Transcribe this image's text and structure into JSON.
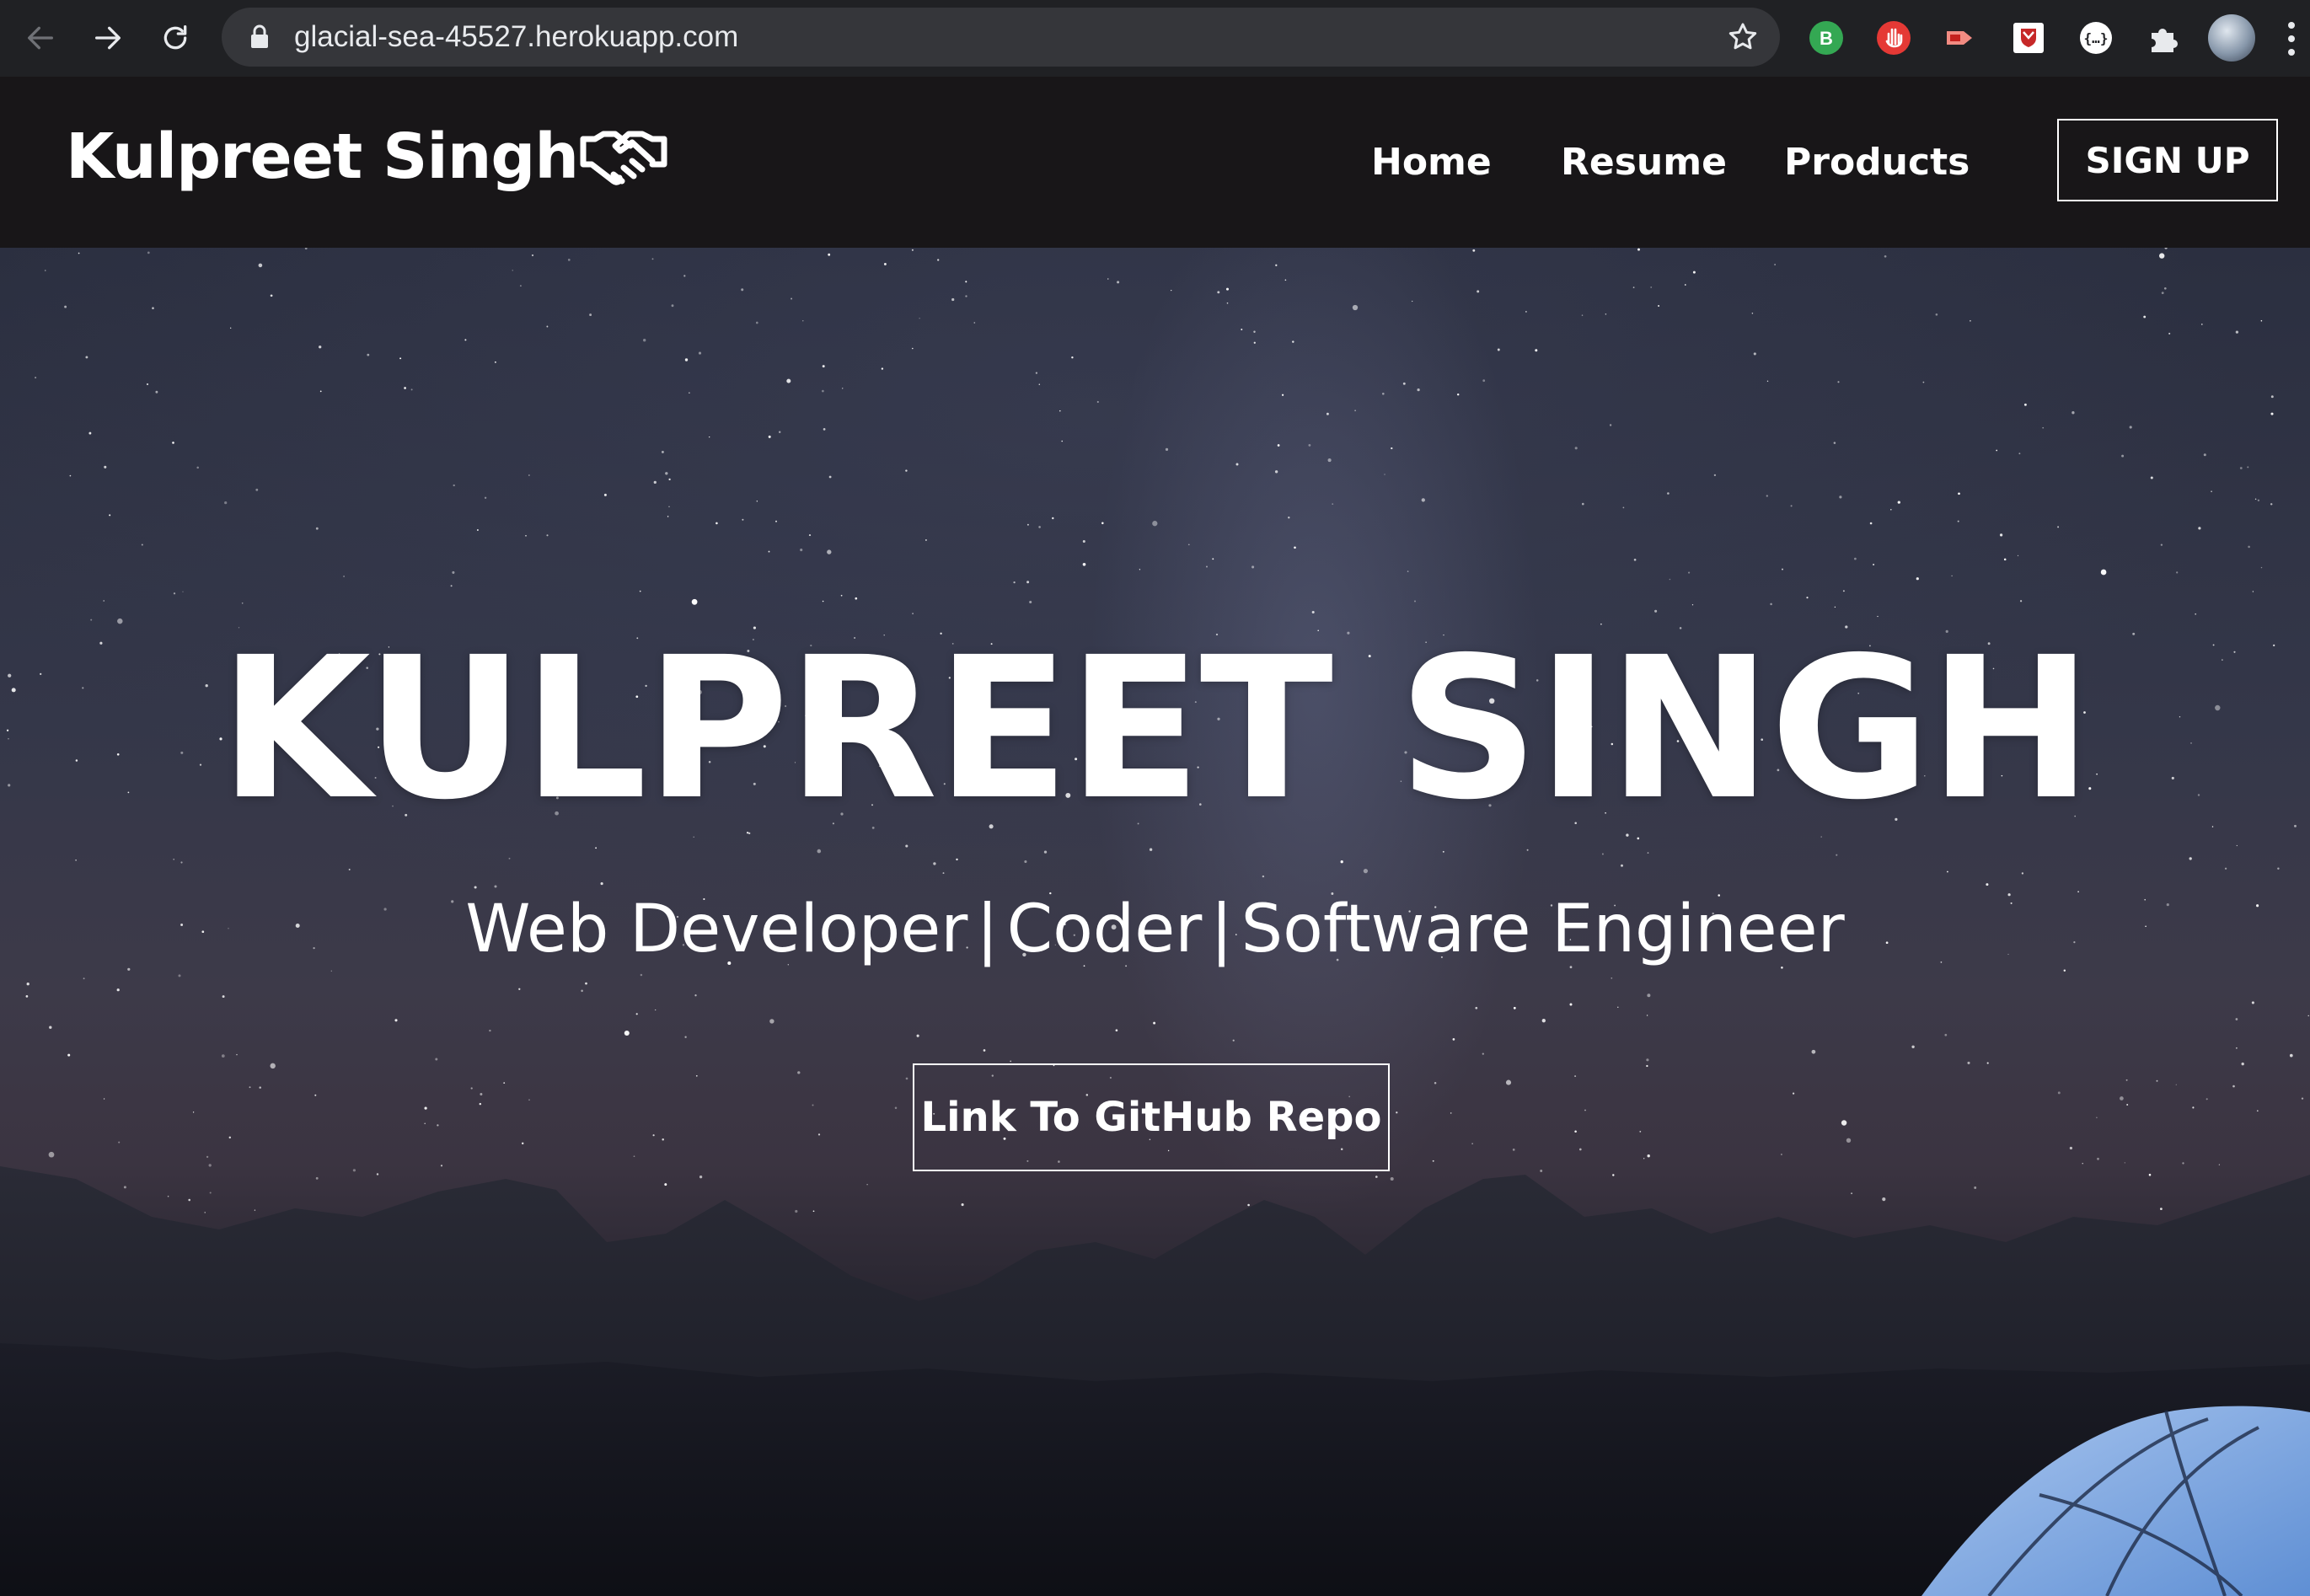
{
  "browser": {
    "url": "glacial-sea-45527.herokuapp.com",
    "extensions": [
      {
        "name": "b-extension-icon",
        "letter": "B",
        "color": "#34a853"
      },
      {
        "name": "hand-stop-icon",
        "color": "#e53935"
      },
      {
        "name": "video-arrow-icon",
        "color": "#f28b82"
      },
      {
        "name": "shield-extension-icon",
        "color": "#c62828"
      },
      {
        "name": "json-braces-icon",
        "color": "#ffffff"
      },
      {
        "name": "puzzle-piece-icon",
        "color": "#e8eaed"
      }
    ]
  },
  "header": {
    "brand": "Kulpreet Singh",
    "nav": [
      "Home",
      "Resume",
      "Products"
    ],
    "signup_label": "SIGN UP"
  },
  "hero": {
    "title": "KULPREET SINGH",
    "subtitle_parts": [
      "Web Developer",
      "|",
      "Coder",
      "|",
      "Software Engineer"
    ],
    "cta_label": "Link To GitHub Repo"
  },
  "colors": {
    "chrome_bg": "#202124",
    "omnibox_bg": "#35363a",
    "header_bg": "#181618",
    "text": "#ffffff"
  }
}
